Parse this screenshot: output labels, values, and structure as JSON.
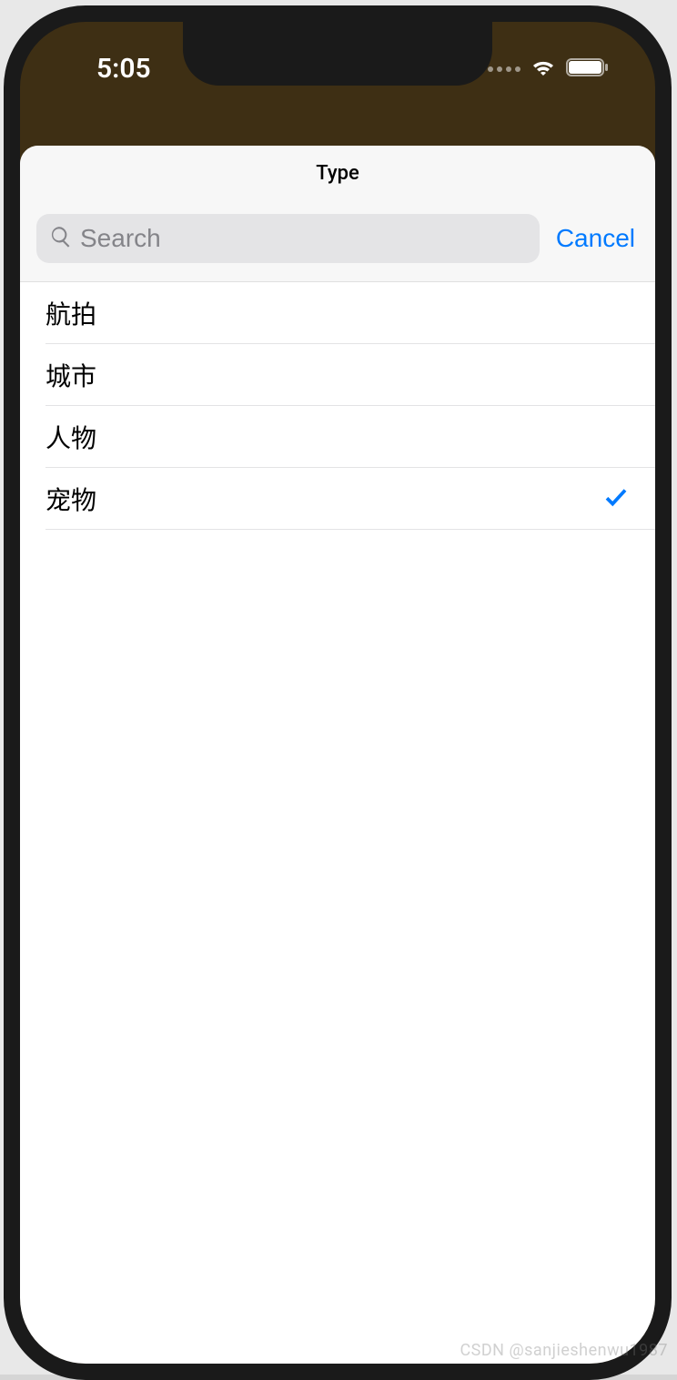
{
  "status": {
    "time": "5:05"
  },
  "modal": {
    "title": "Type",
    "search": {
      "placeholder": "Search"
    },
    "cancel_label": "Cancel"
  },
  "list": {
    "items": [
      {
        "label": "航拍",
        "selected": false
      },
      {
        "label": "城市",
        "selected": false
      },
      {
        "label": "人物",
        "selected": false
      },
      {
        "label": "宠物",
        "selected": true
      }
    ]
  },
  "watermark": "CSDN @sanjieshenwu1987"
}
